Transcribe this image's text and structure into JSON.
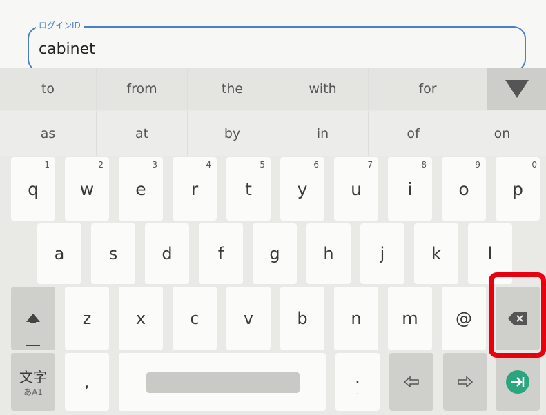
{
  "field": {
    "label": "ログインID",
    "value": "cabinet"
  },
  "suggestions_row1": [
    "to",
    "from",
    "the",
    "with",
    "for"
  ],
  "suggestions_row2": [
    "as",
    "at",
    "by",
    "in",
    "of",
    "on"
  ],
  "row1": [
    {
      "key": "q",
      "num": "1"
    },
    {
      "key": "w",
      "num": "2"
    },
    {
      "key": "e",
      "num": "3"
    },
    {
      "key": "r",
      "num": "4"
    },
    {
      "key": "t",
      "num": "5"
    },
    {
      "key": "y",
      "num": "6"
    },
    {
      "key": "u",
      "num": "7"
    },
    {
      "key": "i",
      "num": "8"
    },
    {
      "key": "o",
      "num": "9"
    },
    {
      "key": "p",
      "num": "0"
    }
  ],
  "row2": [
    "a",
    "s",
    "d",
    "f",
    "g",
    "h",
    "j",
    "k",
    "l"
  ],
  "row3": [
    "z",
    "x",
    "c",
    "v",
    "b",
    "n",
    "m",
    "@"
  ],
  "bottom": {
    "lang_label": "文字",
    "lang_sub": "あA1",
    "comma": ",",
    "period": ".",
    "period_sub": "..."
  },
  "colors": {
    "accent": "#4d7fc4",
    "enter": "#2aa57e",
    "highlight": "#e8000f"
  }
}
